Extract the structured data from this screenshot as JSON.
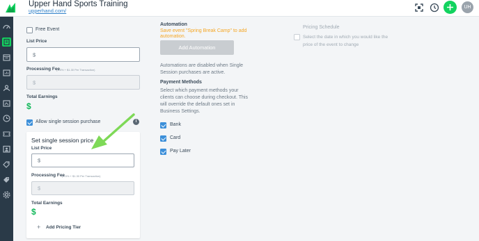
{
  "header": {
    "title": "Upper Hand Sports Training",
    "url": "upperhand.com/",
    "avatar_initials": "UH",
    "icons": [
      "logo-icon",
      "expand-icon",
      "clock-icon",
      "plus-icon"
    ]
  },
  "sidebar": {
    "items": [
      "dashboard-icon",
      "events-icon",
      "calendar-icon",
      "reports-icon",
      "clients-icon",
      "marketing-icon",
      "resources-icon",
      "tickets-icon",
      "staff-icon",
      "coupons-icon",
      "tags-icon",
      "settings-icon"
    ],
    "active_index": 1
  },
  "pricing": {
    "free_event_label": "Free Event",
    "free_event_checked": false,
    "list_price_label": "List Price",
    "list_price_placeholder": "$",
    "processing_fee_label": "Processing Fee",
    "processing_fee_hint": "(3.5% + $1.30 Per Transaction)",
    "processing_fee_placeholder": "$",
    "total_earnings_label": "Total Earnings",
    "total_earnings_value": "$",
    "allow_single_label": "Allow single session purchase",
    "allow_single_checked": true,
    "info_icon": "i"
  },
  "single_session": {
    "title": "Set single session price",
    "list_price_label": "List Price",
    "list_price_placeholder": "$",
    "processing_fee_label": "Processing Fee",
    "processing_fee_hint": "(3.5% + $1.30 Per Transaction)",
    "processing_fee_placeholder": "$",
    "total_earnings_label": "Total Earnings",
    "total_earnings_value": "$",
    "add_tier_label": "Add Pricing Tier"
  },
  "automation": {
    "title": "Automation",
    "warning_line1": "Save event \"Spring Break Camp\" to add",
    "warning_line2": "automation.",
    "add_button": "Add Automation",
    "disabled_line1": "Automations are disabled when Single",
    "disabled_line2": "Session purchases are active."
  },
  "payment": {
    "title": "Payment Methods",
    "desc_line1": "Select which payment methods your",
    "desc_line2": "clients can choose during checkout. This",
    "desc_line3": "will override the default ones set in",
    "desc_line4": "Business Settings.",
    "methods": [
      {
        "label": "Bank",
        "checked": true
      },
      {
        "label": "Card",
        "checked": true
      },
      {
        "label": "Pay Later",
        "checked": true
      }
    ]
  },
  "schedule": {
    "title": "Pricing Schedule",
    "desc_line1": "Select the date in which you would like the",
    "desc_line2": "price of the event to change",
    "checked": false
  },
  "colors": {
    "accent_green": "#12d35f",
    "sidebar_bg": "#2a3a48",
    "checkbox_blue": "#3c8fd9",
    "warning_orange": "#f5a623"
  }
}
